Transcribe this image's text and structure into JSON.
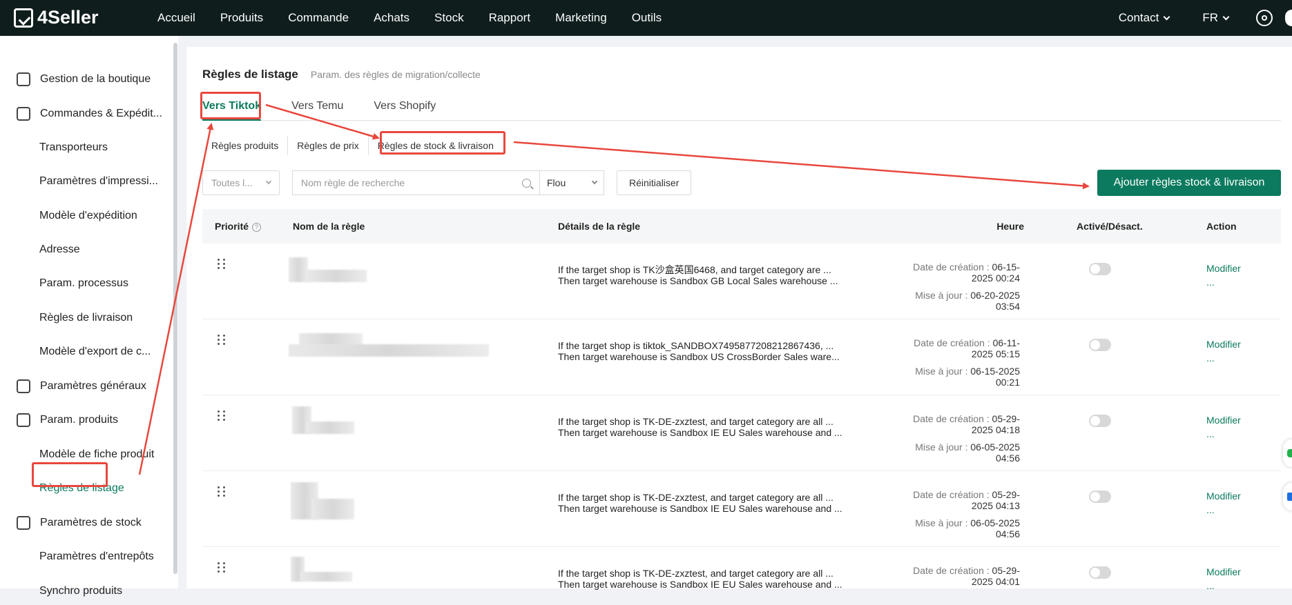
{
  "header": {
    "logo": "4Seller",
    "nav": [
      "Accueil",
      "Produits",
      "Commande",
      "Achats",
      "Stock",
      "Rapport",
      "Marketing",
      "Outils"
    ],
    "contact": "Contact",
    "language": "FR"
  },
  "sidebar": {
    "items": [
      {
        "label": "Gestion de la boutique",
        "type": "section",
        "icon": "store-icon"
      },
      {
        "label": "Commandes & Expédit...",
        "type": "section",
        "icon": "clipboard-icon"
      },
      {
        "label": "Transporteurs",
        "type": "sub"
      },
      {
        "label": "Paramètres d'impressi...",
        "type": "sub"
      },
      {
        "label": "Modèle d'expédition",
        "type": "sub"
      },
      {
        "label": "Adresse",
        "type": "sub"
      },
      {
        "label": "Param. processus",
        "type": "sub"
      },
      {
        "label": "Règles de livraison",
        "type": "sub"
      },
      {
        "label": "Modèle d'export de c...",
        "type": "sub"
      },
      {
        "label": "Paramètres généraux",
        "type": "section",
        "icon": "printer-icon"
      },
      {
        "label": "Param. produits",
        "type": "section",
        "icon": "upload-box-icon"
      },
      {
        "label": "Modèle de fiche produit",
        "type": "sub"
      },
      {
        "label": "Règles de listage",
        "type": "sub",
        "active": true
      },
      {
        "label": "Paramètres de stock",
        "type": "section",
        "icon": "inventory-icon"
      },
      {
        "label": "Paramètres d'entrepôts",
        "type": "sub"
      },
      {
        "label": "Synchro produits",
        "type": "sub"
      }
    ]
  },
  "page": {
    "title": "Règles de listage",
    "subtitle": "Param. des règles de migration/collecte",
    "tabs": [
      "Vers Tiktok",
      "Vers Temu",
      "Vers Shopify"
    ],
    "subtabs": [
      "Règles produits",
      "Règles de prix",
      "Règles de stock & livraison"
    ]
  },
  "filters": {
    "shop_select": "Toutes l...",
    "search_placeholder": "Nom règle de recherche",
    "match_mode": "Flou",
    "reset": "Réinitialiser",
    "add_button": "Ajouter règles stock & livraison"
  },
  "table": {
    "columns": [
      "Priorité",
      "Nom de la règle",
      "Détails de la règle",
      "Heure",
      "Activé/Désact.",
      "Action"
    ],
    "created_label": "Date de création :",
    "updated_label": "Mise à jour :",
    "action_label": "Modifier",
    "more_label": "...",
    "rows": [
      {
        "detail1": "If the target shop is TK沙盒英国6468, and target category are ...",
        "detail2": "Then target warehouse is Sandbox GB Local Sales warehouse ...",
        "created_a": "06-15-",
        "created_b": "2025 00:24",
        "updated_a": "06-20-2025",
        "updated_b": "03:54"
      },
      {
        "detail1": "If the target shop is tiktok_SANDBOX7495877208212867436, ...",
        "detail2": "Then target warehouse is Sandbox US CrossBorder Sales ware...",
        "created_a": "06-11-",
        "created_b": "2025 05:15",
        "updated_a": "06-15-2025",
        "updated_b": "00:21"
      },
      {
        "detail1": "If the target shop is TK-DE-zxztest, and target category are all ...",
        "detail2": "Then target warehouse is Sandbox IE EU Sales warehouse and ...",
        "created_a": "05-29-",
        "created_b": "2025 04:18",
        "updated_a": "06-05-2025",
        "updated_b": "04:56"
      },
      {
        "detail1": "If the target shop is TK-DE-zxztest, and target category are all ...",
        "detail2": "Then target warehouse is Sandbox IE EU Sales warehouse and ...",
        "created_a": "05-29-",
        "created_b": "2025 04:13",
        "updated_a": "06-05-2025",
        "updated_b": "04:56"
      },
      {
        "detail1": "If the target shop is TK-DE-zxztest, and target category are all ...",
        "detail2": "Then target warehouse is Sandbox IE EU Sales warehouse and ...",
        "created_a": "05-29-",
        "created_b": "2025 04:01",
        "updated_a": "",
        "updated_b": ""
      }
    ]
  },
  "colors": {
    "accent": "#0b7a5e",
    "topbar": "#0f1d1d",
    "annotation": "#e8473d"
  }
}
